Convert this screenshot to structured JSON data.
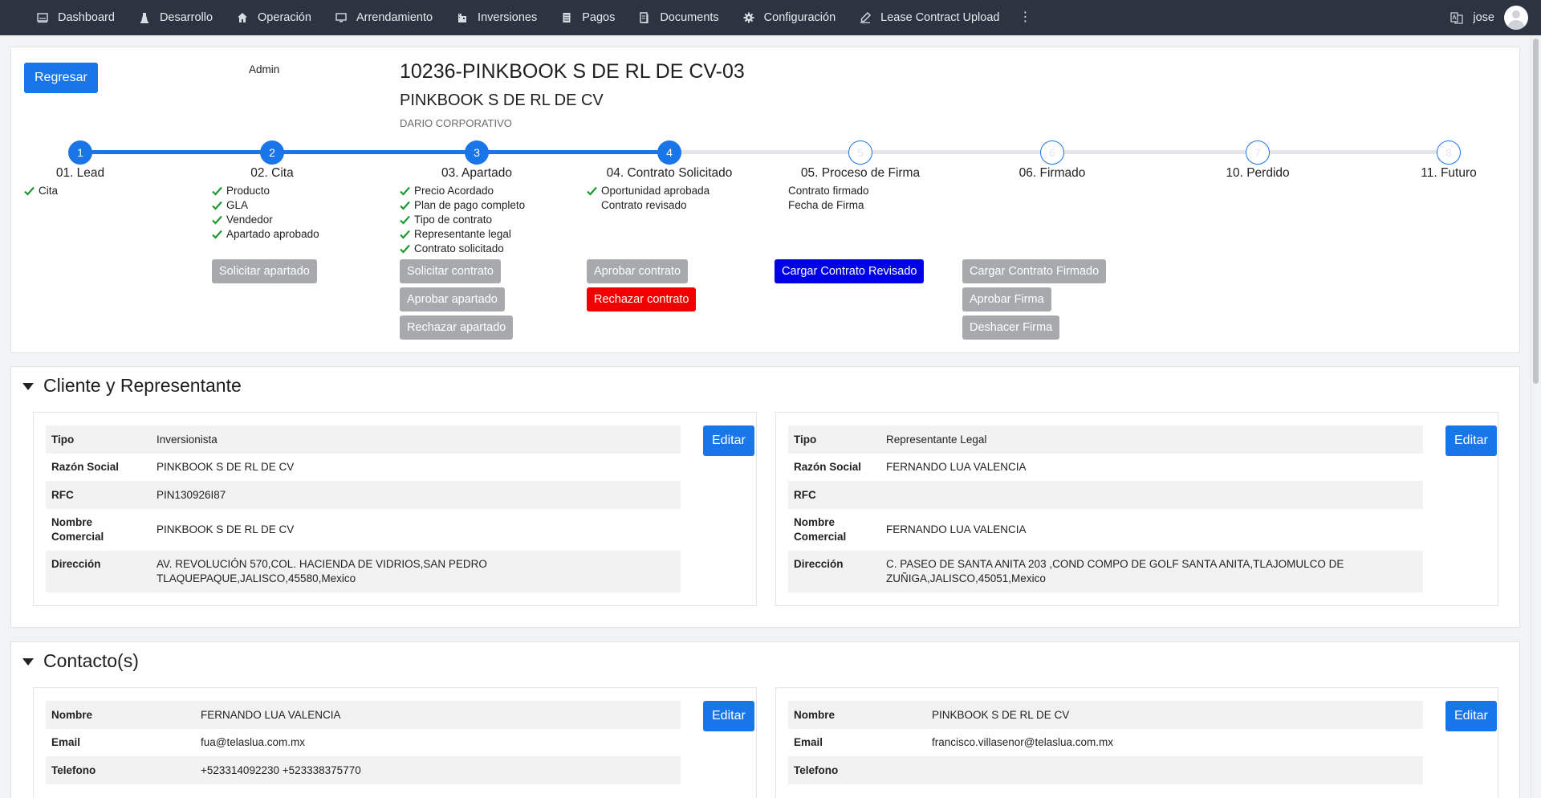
{
  "nav": {
    "items": [
      {
        "label": "Dashboard",
        "icon": "dashboard-icon"
      },
      {
        "label": "Desarrollo",
        "icon": "development-icon"
      },
      {
        "label": "Operación",
        "icon": "home-icon"
      },
      {
        "label": "Arrendamiento",
        "icon": "monitor-icon"
      },
      {
        "label": "Inversiones",
        "icon": "building-icon"
      },
      {
        "label": "Pagos",
        "icon": "receipt-icon"
      },
      {
        "label": "Documents",
        "icon": "document-icon"
      },
      {
        "label": "Configuración",
        "icon": "gear-icon"
      },
      {
        "label": "Lease Contract Upload",
        "icon": "pen-icon"
      }
    ],
    "more": "⋮",
    "user": "jose"
  },
  "header": {
    "back_button": "Regresar",
    "role": "Admin",
    "title": "10236-PINKBOOK S DE RL DE CV-03",
    "subtitle": "PINKBOOK S DE RL DE CV",
    "small": "DARIO CORPORATIVO"
  },
  "stages": [
    {
      "n": "1",
      "label": "01. Lead",
      "done": true
    },
    {
      "n": "2",
      "label": "02. Cita",
      "done": true
    },
    {
      "n": "3",
      "label": "03. Apartado",
      "done": true
    },
    {
      "n": "4",
      "label": "04. Contrato Solicitado",
      "done": true
    },
    {
      "n": "5",
      "label": "05. Proceso de Firma",
      "done": false
    },
    {
      "n": "6",
      "label": "06. Firmado",
      "done": false
    },
    {
      "n": "7",
      "label": "10. Perdido",
      "done": false
    },
    {
      "n": "8",
      "label": "11. Futuro",
      "done": false
    }
  ],
  "requirements": {
    "lead": [
      "Cita"
    ],
    "cita": [
      "Producto",
      "GLA",
      "Vendedor",
      "Apartado aprobado"
    ],
    "apartado": [
      "Precio Acordado",
      "Plan de pago completo",
      "Tipo de contrato",
      "Representante legal",
      "Contrato solicitado"
    ],
    "contrato": [
      "Oportunidad aprobada",
      "Contrato revisado"
    ],
    "firma": [
      "Contrato firmado",
      "Fecha de Firma"
    ]
  },
  "actions": {
    "solicitar_apartado": "Solicitar apartado",
    "solicitar_contrato": "Solicitar contrato",
    "aprobar_apartado": "Aprobar apartado",
    "rechazar_apartado": "Rechazar apartado",
    "aprobar_contrato": "Aprobar contrato",
    "rechazar_contrato": "Rechazar contrato",
    "cargar_revisado": "Cargar Contrato Revisado",
    "cargar_firmado": "Cargar Contrato Firmado",
    "aprobar_firma": "Aprobar Firma",
    "deshacer_firma": "Deshacer Firma"
  },
  "cliente": {
    "section_title": "Cliente y Representante",
    "edit_label": "Editar",
    "left": {
      "tipo_k": "Tipo",
      "tipo_v": "Inversionista",
      "razon_k": "Razón Social",
      "razon_v": "PINKBOOK S DE RL DE CV",
      "rfc_k": "RFC",
      "rfc_v": "PIN130926I87",
      "nombre_k1": "Nombre",
      "nombre_k2": "Comercial",
      "nombre_v": "PINKBOOK S DE RL DE CV",
      "dir_k": "Dirección",
      "dir_v1": "AV. REVOLUCIÓN 570,COL. HACIENDA DE VIDRIOS,SAN PEDRO",
      "dir_v2": "TLAQUEPAQUE,JALISCO,45580,Mexico"
    },
    "right": {
      "tipo_k": "Tipo",
      "tipo_v": "Representante Legal",
      "razon_k": "Razón Social",
      "razon_v": "FERNANDO LUA VALENCIA",
      "rfc_k": "RFC",
      "rfc_v": "",
      "nombre_k1": "Nombre",
      "nombre_k2": "Comercial",
      "nombre_v": "FERNANDO LUA VALENCIA",
      "dir_k": "Dirección",
      "dir_v1": "C. PASEO DE SANTA ANITA 203 ,COND COMPO DE GOLF SANTA ANITA,TLAJOMULCO DE",
      "dir_v2": "ZUÑIGA,JALISCO,45051,Mexico"
    }
  },
  "contactos": {
    "section_title": "Contacto(s)",
    "edit_label": "Editar",
    "left": {
      "nombre_k": "Nombre",
      "nombre_v": "FERNANDO LUA VALENCIA",
      "email_k": "Email",
      "email_v": "fua@telaslua.com.mx",
      "tel_k": "Telefono",
      "tel_v": "+523314092230 +523338375770"
    },
    "right": {
      "nombre_k": "Nombre",
      "nombre_v": "PINKBOOK S DE RL DE CV",
      "email_k": "Email",
      "email_v": "francisco.villasenor@telaslua.com.mx",
      "tel_k": "Telefono",
      "tel_v": ""
    }
  },
  "colors": {
    "primary": "#1976e8",
    "gray_button": "#a7a9ad",
    "danger": "#f20000",
    "navy": "#0000e6",
    "nav_bg": "#2d3441",
    "check": "#1b9a2f"
  }
}
